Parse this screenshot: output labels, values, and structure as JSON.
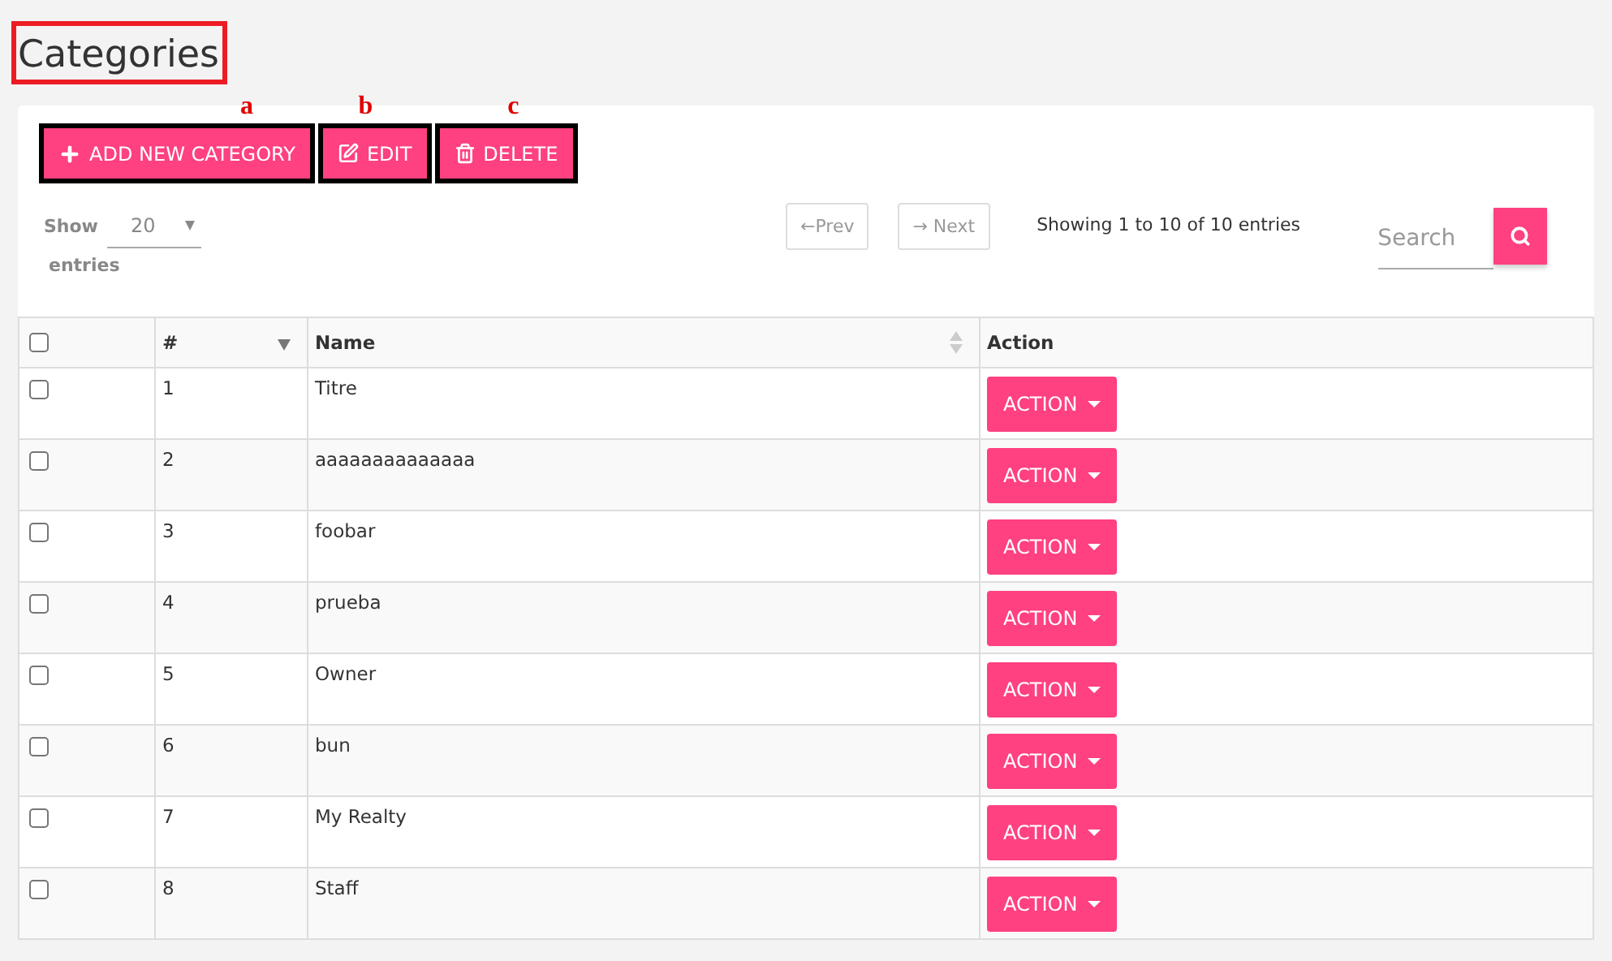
{
  "page_title": {
    "text": "Categories",
    "highlighted": true
  },
  "toolbar": [
    {
      "kind": "add",
      "label": "ADD NEW CATEGORY",
      "highlighted": true,
      "marker": "a"
    },
    {
      "kind": "edit",
      "label": "EDIT",
      "highlighted": true,
      "marker": "b"
    },
    {
      "kind": "delete",
      "label": "DELETE",
      "highlighted": true,
      "marker": "c"
    }
  ],
  "length_menu": {
    "show_label": "Show",
    "value": "20",
    "entries_label": "entries"
  },
  "pagination": {
    "prev": "←Prev",
    "next": "→ Next"
  },
  "info": "Showing 1 to 10 of 10 entries",
  "search": {
    "placeholder": "Search"
  },
  "table": {
    "columns": [
      {
        "kind": "checkbox",
        "checked": false
      },
      {
        "kind": "text",
        "label": "#",
        "sortable": true,
        "sorted": true
      },
      {
        "kind": "text",
        "label": "Name",
        "sortable": true,
        "sorted": false
      },
      {
        "kind": "text",
        "label": "Action"
      }
    ],
    "rows": [
      {
        "checked": false,
        "number": "1",
        "name": "Titre",
        "action": "ACTION"
      },
      {
        "checked": false,
        "number": "2",
        "name": "aaaaaaaaaaaaaa",
        "action": "ACTION"
      },
      {
        "checked": false,
        "number": "3",
        "name": "foobar",
        "action": "ACTION"
      },
      {
        "checked": false,
        "number": "4",
        "name": "prueba",
        "action": "ACTION"
      },
      {
        "checked": false,
        "number": "5",
        "name": "Owner",
        "action": "ACTION"
      },
      {
        "checked": false,
        "number": "6",
        "name": "bun",
        "action": "ACTION"
      },
      {
        "checked": false,
        "number": "7",
        "name": "My Realty",
        "action": "ACTION"
      },
      {
        "checked": false,
        "number": "8",
        "name": "Staff",
        "action": "ACTION"
      }
    ]
  }
}
